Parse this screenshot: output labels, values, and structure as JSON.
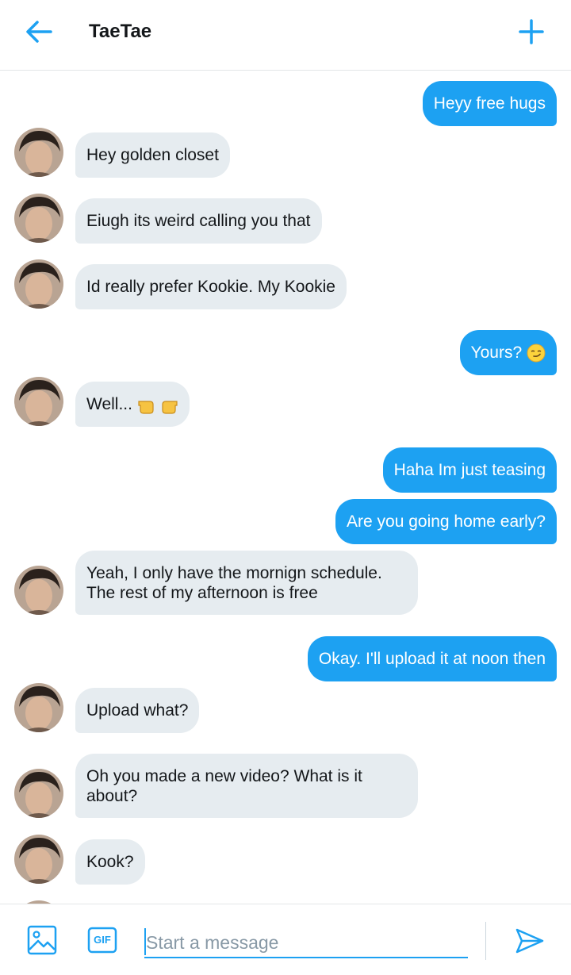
{
  "header": {
    "back_icon": "arrow-left-icon",
    "title": "TaeTae",
    "new_icon": "plus-icon",
    "accent": "#1da1f2"
  },
  "messages": [
    {
      "side": "out",
      "text": "Heyy free hugs"
    },
    {
      "side": "in",
      "text": "Hey golden closet"
    },
    {
      "side": "in",
      "text": "Eiugh its weird calling you that"
    },
    {
      "side": "in",
      "text": "Id really prefer Kookie. My Kookie"
    },
    {
      "side": "out",
      "text": "Yours?",
      "emoji": "smirk-emoji"
    },
    {
      "side": "in",
      "text": "Well...",
      "emoji": "pointing-fingers-emoji"
    },
    {
      "side": "out",
      "text": "Haha Im just teasing"
    },
    {
      "side": "out",
      "text": "Are you going home early?"
    },
    {
      "side": "in",
      "line1": "Yeah, I only have the mornign schedule.",
      "line2": "The rest of my afternoon is free"
    },
    {
      "side": "out",
      "text": "Okay. I'll upload it at noon then"
    },
    {
      "side": "in",
      "text": "Upload what?"
    },
    {
      "side": "in",
      "line1": "Oh you made a new video? What is it",
      "line2": "about?"
    },
    {
      "side": "in",
      "text": "Kook?"
    }
  ],
  "composer": {
    "media_icon": "image-icon",
    "gif_label": "GIF",
    "placeholder": "Start a message",
    "send_icon": "send-icon"
  },
  "colors": {
    "incoming_bubble": "#e6ecf0",
    "outgoing_bubble": "#1da1f2"
  }
}
